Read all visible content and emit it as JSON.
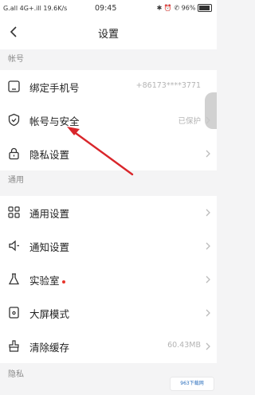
{
  "status_bar": {
    "left": "G.all 4G+.ill 19.6K/s",
    "time": "09:45",
    "right": "✱ ⏰ ✆ 96%"
  },
  "nav": {
    "title": "设置"
  },
  "sections": {
    "account": "帐号",
    "general": "通用",
    "privacy": "隐私"
  },
  "items": {
    "bind_phone": {
      "label": "绑定手机号",
      "value": "+86173****3771"
    },
    "account_security": {
      "label": "帐号与安全",
      "value": "已保护"
    },
    "privacy_settings": {
      "label": "隐私设置"
    },
    "general_settings": {
      "label": "通用设置"
    },
    "notification_settings": {
      "label": "通知设置"
    },
    "lab": {
      "label": "实验室"
    },
    "big_screen": {
      "label": "大屏模式"
    },
    "clear_cache": {
      "label": "清除缓存",
      "value": "60.43MB"
    }
  },
  "watermark": "963下载网",
  "battery_level": 0.96,
  "colors": {
    "accent_red": "#e7352b",
    "arrow_red": "#d9262b"
  }
}
